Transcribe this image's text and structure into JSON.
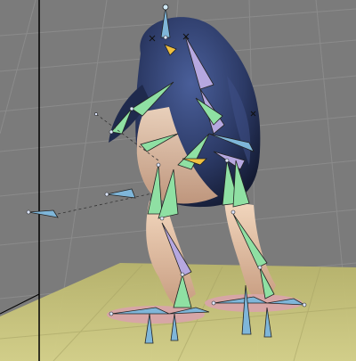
{
  "viewport": {
    "type": "3d-viewport",
    "colors": {
      "background": "#7b7b7b",
      "grid": "#8c8c8c",
      "ground_plane": "#c9c67a",
      "mesh_body": "#2c3a66",
      "mesh_belly": "#e8c5a8",
      "bone_green": "#8fe0a3",
      "bone_blue": "#7fb6d9",
      "bone_purple": "#b6a8e0",
      "bone_selected": "#f0c040",
      "z_axis": "#000000"
    },
    "scene_objects": [
      "penguin-mesh",
      "armature",
      "ground-plane",
      "z-axis-line"
    ]
  }
}
